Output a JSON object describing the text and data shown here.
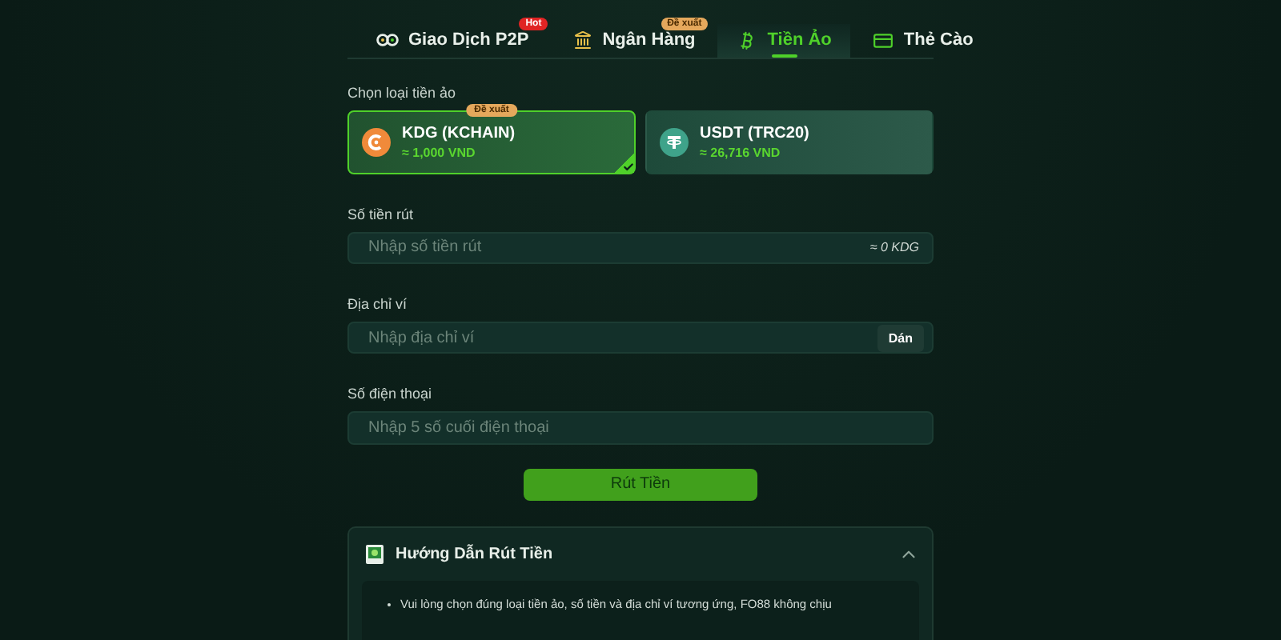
{
  "tabs": [
    {
      "label": "Giao Dịch P2P",
      "kind": "p2p",
      "selected": false,
      "badge": {
        "text": "Hot",
        "kind": "hot"
      }
    },
    {
      "label": "Ngân Hàng",
      "kind": "bank",
      "selected": false,
      "badge": {
        "text": "Đề xuất",
        "kind": "suggest"
      }
    },
    {
      "label": "Tiền Ảo",
      "kind": "crypto",
      "selected": true
    },
    {
      "label": "Thẻ Cào",
      "kind": "card",
      "selected": false
    }
  ],
  "coin_label": "Chọn loại tiền ảo",
  "coins": [
    {
      "name": "KDG (KCHAIN)",
      "rate": "≈ 1,000 VND",
      "kind": "kdg",
      "selected": true,
      "badge": "Đề xuất"
    },
    {
      "name": "USDT (TRC20)",
      "rate": "≈ 26,716 VND",
      "kind": "usdt",
      "selected": false
    }
  ],
  "fields": [
    {
      "label": "Số tiền rút",
      "placeholder": "Nhập số tiền rút",
      "suffix": "≈ 0 KDG"
    },
    {
      "label": "Địa chỉ ví",
      "placeholder": "Nhập địa chỉ ví",
      "button": "Dán"
    },
    {
      "label": "Số điện thoại",
      "placeholder": "Nhập 5 số cuối điện thoại"
    }
  ],
  "submit": "Rút Tiền",
  "guide": {
    "title": "Hướng Dẫn Rút Tiền",
    "expanded": true,
    "items": [
      "Vui lòng chọn đúng loại tiền ảo, số tiền và địa chỉ ví tương ứng, FO88 không chịu"
    ]
  }
}
